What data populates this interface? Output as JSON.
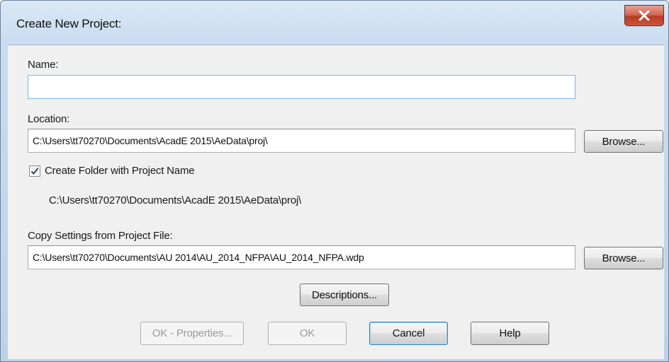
{
  "window": {
    "title": "Create New Project:"
  },
  "icons": {
    "close": "close-icon",
    "checkmark": "checkmark-icon"
  },
  "name_field": {
    "label": "Name:",
    "value": ""
  },
  "location_field": {
    "label": "Location:",
    "value": "C:\\Users\\tt70270\\Documents\\AcadE 2015\\AeData\\proj\\",
    "browse_label": "Browse..."
  },
  "create_folder": {
    "label": "Create Folder with Project Name",
    "checked": true,
    "resolved_path": "C:\\Users\\tt70270\\Documents\\AcadE 2015\\AeData\\proj\\"
  },
  "copy_settings_field": {
    "label": "Copy Settings from Project File:",
    "value": "C:\\Users\\tt70270\\Documents\\AU 2014\\AU_2014_NFPA\\AU_2014_NFPA.wdp",
    "browse_label": "Browse..."
  },
  "buttons": {
    "descriptions": "Descriptions...",
    "ok_properties": "OK - Properties...",
    "ok": "OK",
    "cancel": "Cancel",
    "help": "Help"
  },
  "colors": {
    "close_button": "#c8563f",
    "focus_border": "#7eb4ea"
  }
}
